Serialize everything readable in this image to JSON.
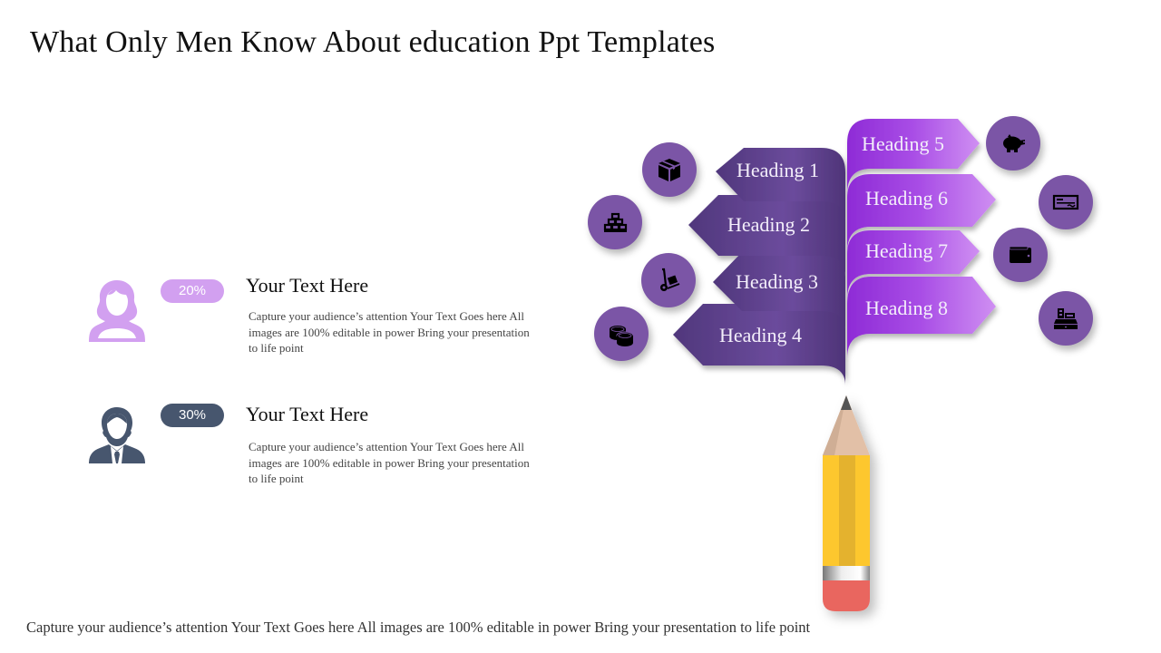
{
  "title": "What Only Men Know About education Ppt Templates",
  "items": [
    {
      "icon": "woman-avatar-icon",
      "percent": "20%",
      "badge_color": "#d2a0f0",
      "icon_color": "#d2a0f0",
      "title": "Your Text Here",
      "description": "Capture your audience’s attention Your Text Goes here All images are 100% editable in power Bring your presentation  to life point"
    },
    {
      "icon": "man-avatar-icon",
      "percent": "30%",
      "badge_color": "#47566e",
      "icon_color": "#47566e",
      "title": "Your Text Here",
      "description": "Capture your audience’s attention Your Text Goes here All images are 100% editable in power Bring your presentation  to life point"
    }
  ],
  "headings_left": [
    {
      "label": "Heading 1",
      "icon": "box-icon"
    },
    {
      "label": "Heading 2",
      "icon": "gold-bars-icon"
    },
    {
      "label": "Heading 3",
      "icon": "hand-truck-icon"
    },
    {
      "label": "Heading 4",
      "icon": "coins-icon"
    }
  ],
  "headings_right": [
    {
      "label": "Heading 5",
      "icon": "piggy-bank-icon"
    },
    {
      "label": "Heading 6",
      "icon": "cheque-icon"
    },
    {
      "label": "Heading 7",
      "icon": "wallet-icon"
    },
    {
      "label": "Heading 8",
      "icon": "cash-register-icon"
    }
  ],
  "colors": {
    "left_ribbon": "#5c3f8c",
    "right_ribbon": "#a23fe0",
    "icon_circle": "#7b55a6",
    "pencil_body": "#fdc72e",
    "pencil_eraser": "#e9665f"
  },
  "footer": "Capture your audience’s attention Your Text Goes here All images are 100% editable in power Bring your presentation to life point"
}
